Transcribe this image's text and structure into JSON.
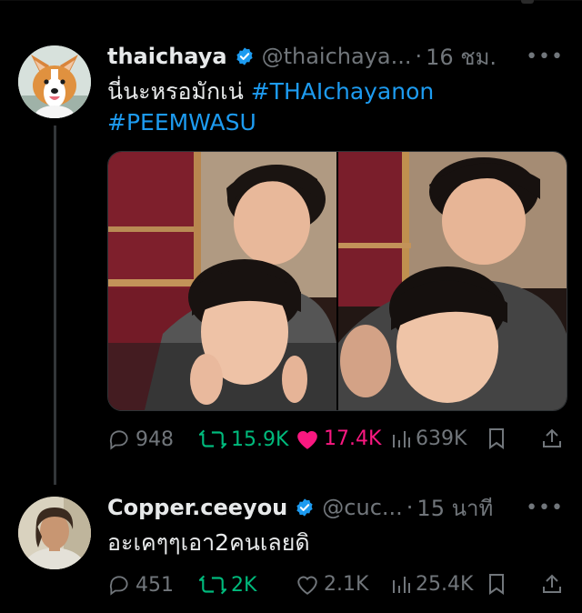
{
  "tweets": [
    {
      "author_name": "thaichaya",
      "handle": "@thaichaya...",
      "separator": "·",
      "time": "16 ชม.",
      "more": "•••",
      "text": "นี่นะหรอมักเน่ ",
      "hashtags": [
        "#THAIchayanon",
        "#PEEMWASU"
      ],
      "media_count": 2,
      "stats": {
        "replies": "948",
        "retweets": "15.9K",
        "likes": "17.4K",
        "views": "639K"
      },
      "liked": true
    },
    {
      "author_name": "Copper.ceeyou",
      "handle": "@cuc...",
      "separator": "·",
      "time": "15 นาที",
      "more": "•••",
      "text": "อะเคๆๆเอา2คนเลยดิ",
      "stats": {
        "replies": "451",
        "retweets": "2K",
        "likes": "2.1K",
        "views": "25.4K"
      },
      "liked": false
    }
  ],
  "colors": {
    "background": "#000000",
    "accent": "#1d9bf0",
    "retweet": "#00ba7c",
    "like": "#f91880",
    "secondary": "#71767b"
  },
  "icons": [
    "reply-icon",
    "retweet-icon",
    "like-icon",
    "views-icon",
    "bookmark-icon",
    "share-icon",
    "verified-icon",
    "more-icon"
  ]
}
